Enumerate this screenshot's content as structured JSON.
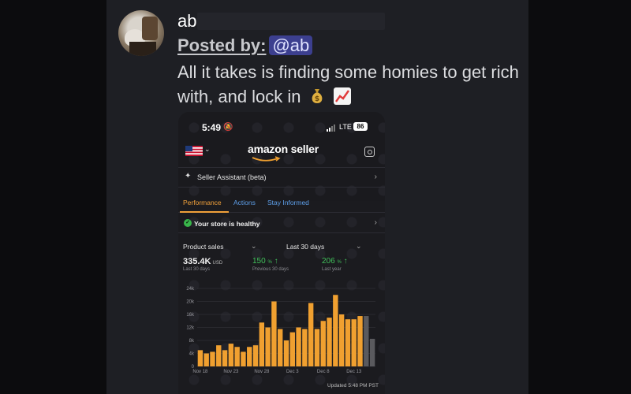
{
  "post": {
    "username": "ab",
    "posted_by_label": "Posted by:",
    "mention": "@ab",
    "message": "All it takes is finding some homies to get rich with, and lock in",
    "emojis": [
      "money-bag-icon",
      "chart-increasing-icon"
    ]
  },
  "phone": {
    "status_time": "5:49",
    "network": "LTE",
    "battery": "86",
    "brand": "amazon seller",
    "assistant_label": "Seller Assistant (beta)",
    "tabs": [
      "Performance",
      "Actions",
      "Stay Informed"
    ],
    "active_tab": "Performance",
    "health_status": "Your store is healthy",
    "metric_dropdown": "Product sales",
    "period_dropdown": "Last 30 days",
    "metrics": [
      {
        "value": "335.4K",
        "unit": "USD",
        "sub": "Last 30 days"
      },
      {
        "value": "150",
        "unit": "%",
        "sub": "Previous 30 days"
      },
      {
        "value": "206",
        "unit": "%",
        "sub": "Last year"
      }
    ],
    "updated": "Updated 5:48 PM PST"
  },
  "chart_data": {
    "type": "bar",
    "categories": [
      "Nov 18",
      "",
      "",
      "",
      "",
      "Nov 23",
      "",
      "",
      "",
      "",
      "Nov 28",
      "",
      "",
      "",
      "",
      "Dec 3",
      "",
      "",
      "",
      "",
      "Dec 8",
      "",
      "",
      "",
      "",
      "Dec 13",
      "",
      "",
      ""
    ],
    "tick_labels": [
      "Nov 18",
      "Nov 23",
      "Nov 28",
      "Dec 3",
      "Dec 8",
      "Dec 13"
    ],
    "values": [
      5000,
      4000,
      4500,
      6500,
      5000,
      7000,
      6000,
      4500,
      6000,
      6500,
      13500,
      12000,
      20000,
      11500,
      8000,
      10500,
      12000,
      11500,
      19500,
      11500,
      14000,
      15000,
      22000,
      16000,
      14500,
      14500,
      15500,
      15500,
      8500
    ],
    "partial_from_index": 27,
    "yticks": [
      "0",
      "4k",
      "8k",
      "12k",
      "16k",
      "20k",
      "24k"
    ],
    "ylim": [
      0,
      24000
    ],
    "colors": {
      "bar": "#f0a030",
      "partial": "#5a5a5e"
    }
  }
}
